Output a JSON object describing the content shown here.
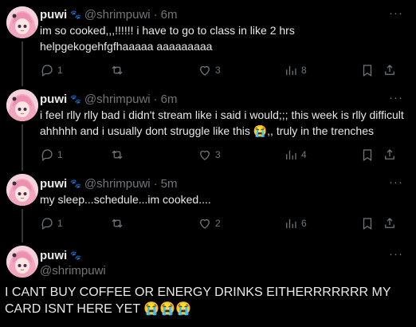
{
  "tweets": [
    {
      "name": "puwi",
      "paw": "🐾",
      "handle": "@shrimpuwi",
      "dot": "·",
      "time": "6m",
      "text": "im so cooked,,,!!!!!! i have to go to class in like 2 hrs helpgekogehfgfhaaaaa aaaaaaaaa",
      "replies": "1",
      "reposts": "",
      "likes": "3",
      "views": "8"
    },
    {
      "name": "puwi",
      "paw": "🐾",
      "handle": "@shrimpuwi",
      "dot": "·",
      "time": "6m",
      "text": "i feel rlly rlly bad i didn't stream like i said i would;;; this week is rlly difficult ahhhhh and i usually dont struggle like this 😭,, truly in the trenches",
      "replies": "1",
      "reposts": "",
      "likes": "3",
      "views": "4"
    },
    {
      "name": "puwi",
      "paw": "🐾",
      "handle": "@shrimpuwi",
      "dot": "·",
      "time": "5m",
      "text": "my sleep...schedule...im cooked....",
      "replies": "1",
      "reposts": "",
      "likes": "2",
      "views": "6"
    }
  ],
  "main": {
    "name": "puwi",
    "paw": "🐾",
    "handle": "@shrimpuwi",
    "text": "I CANT BUY COFFEE OR ENERGY DRINKS EITHERRRRRRR MY CARD ISNT HERE YET 😭😭😭"
  },
  "more_label": "···",
  "icons": {
    "reply": "reply-icon",
    "repost": "repost-icon",
    "like": "heart-icon",
    "views": "views-icon",
    "bookmark": "bookmark-icon",
    "share": "share-icon"
  },
  "colors": {
    "background": "#000000",
    "text": "#e7e9ea",
    "muted": "#71767b",
    "divider": "#2f3336"
  }
}
